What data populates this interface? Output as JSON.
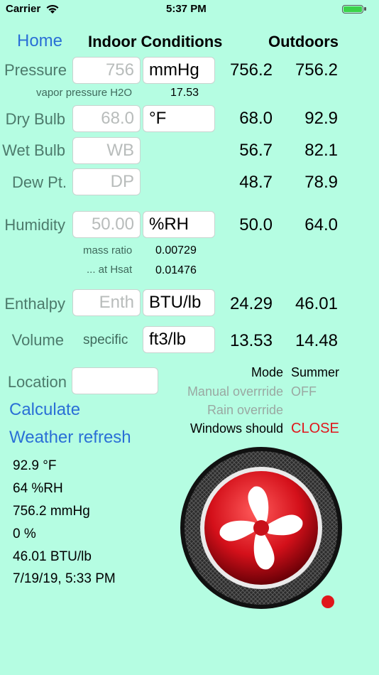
{
  "status_bar": {
    "carrier": "Carrier",
    "time": "5:37 PM"
  },
  "header": {
    "home": "Home",
    "indoor": "Indoor Conditions",
    "outdoors": "Outdoors"
  },
  "pressure": {
    "label": "Pressure",
    "placeholder": "756",
    "unit": "mmHg",
    "indoor": "756.2",
    "outdoor": "756.2"
  },
  "vapor": {
    "label": "vapor pressure H2O",
    "value": "17.53"
  },
  "dry_bulb": {
    "label": "Dry Bulb",
    "placeholder": "68.0",
    "unit": "°F",
    "indoor": "68.0",
    "outdoor": "92.9"
  },
  "wet_bulb": {
    "label": "Wet Bulb",
    "placeholder": "WB",
    "indoor": "56.7",
    "outdoor": "82.1"
  },
  "dew_point": {
    "label": "Dew Pt.",
    "placeholder": "DP",
    "indoor": "48.7",
    "outdoor": "78.9"
  },
  "humidity": {
    "label": "Humidity",
    "placeholder": "50.00",
    "unit": "%RH",
    "indoor": "50.0",
    "outdoor": "64.0"
  },
  "mass_ratio": {
    "label": "mass ratio",
    "value": "0.00729"
  },
  "at_hsat": {
    "label": "... at Hsat",
    "value": "0.01476"
  },
  "enthalpy": {
    "label": "Enthalpy",
    "placeholder": "Enth",
    "unit": "BTU/lb",
    "indoor": "24.29",
    "outdoor": "46.01"
  },
  "volume": {
    "label": "Volume",
    "sub": "specific",
    "unit": "ft3/lb",
    "indoor": "13.53",
    "outdoor": "14.48"
  },
  "location": {
    "label": "Location",
    "value": ""
  },
  "actions": {
    "calculate": "Calculate",
    "weather_refresh": "Weather refresh"
  },
  "mode": {
    "label": "Mode",
    "value": "Summer"
  },
  "manual_override": {
    "label": "Manual overrride",
    "value": "OFF"
  },
  "rain_override": {
    "label": "Rain override"
  },
  "windows": {
    "label": "Windows should",
    "value": "CLOSE"
  },
  "weather": [
    "92.9 °F",
    "64 %RH",
    "756.2 mmHg",
    "0 %",
    "46.01  BTU/lb",
    "7/19/19, 5:33 PM"
  ],
  "colors": {
    "background": "#b5fde2",
    "accent": "#2a6fd6",
    "alert": "#e0161b"
  },
  "icons": {
    "fan": "fan-icon",
    "wifi": "wifi-icon",
    "battery": "battery-icon"
  }
}
